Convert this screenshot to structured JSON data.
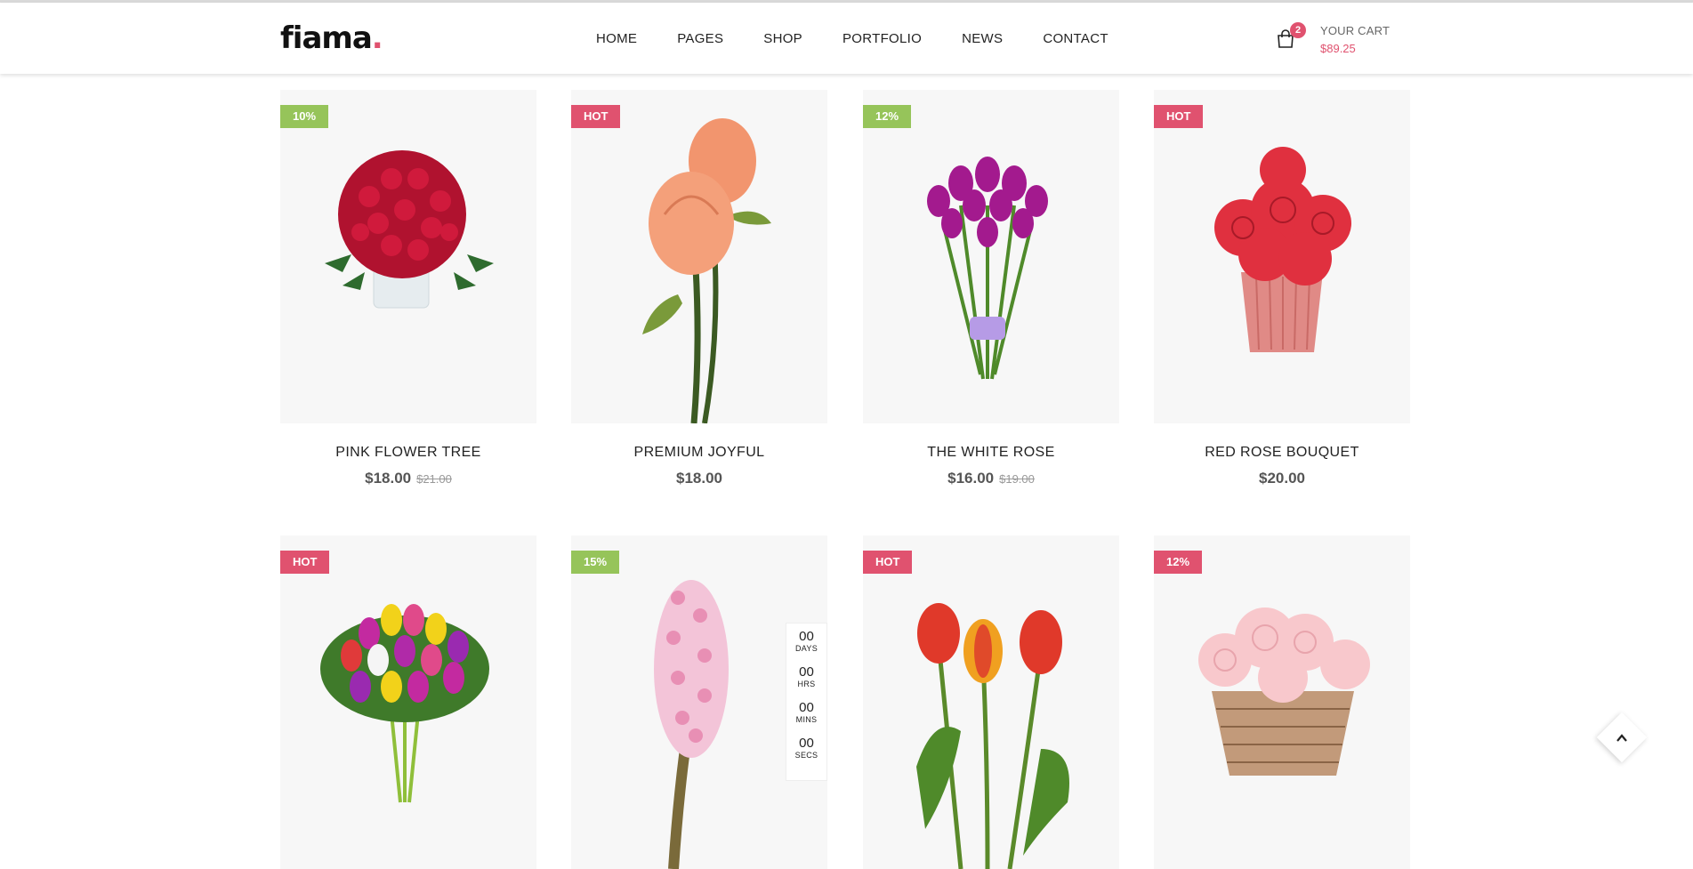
{
  "logo": {
    "text": "fiama",
    "dot": "."
  },
  "nav": [
    "HOME",
    "PAGES",
    "SHOP",
    "PORTFOLIO",
    "NEWS",
    "CONTACT"
  ],
  "cart": {
    "count": "2",
    "title": "YOUR CART",
    "total": "$89.25"
  },
  "products": [
    {
      "badge": "10%",
      "badge_color": "green",
      "title": "PINK FLOWER TREE",
      "price": "$18.00",
      "old_price": "$21.00",
      "image_icon": "red-roses-vase"
    },
    {
      "badge": "HOT",
      "badge_color": "pink",
      "title": "PREMIUM JOYFUL",
      "price": "$18.00",
      "old_price": "",
      "image_icon": "peach-roses"
    },
    {
      "badge": "12%",
      "badge_color": "green",
      "title": "THE WHITE ROSE",
      "price": "$16.00",
      "old_price": "$19.00",
      "image_icon": "purple-tulips"
    },
    {
      "badge": "HOT",
      "badge_color": "pink",
      "title": "RED ROSE BOUQUET",
      "price": "$20.00",
      "old_price": "",
      "image_icon": "red-roses-pot"
    },
    {
      "badge": "HOT",
      "badge_color": "pink",
      "title": "",
      "price": "",
      "old_price": "",
      "image_icon": "mixed-tulips"
    },
    {
      "badge": "15%",
      "badge_color": "green",
      "title": "",
      "price": "",
      "old_price": "",
      "image_icon": "pink-hyacinth"
    },
    {
      "badge": "HOT",
      "badge_color": "pink",
      "title": "",
      "price": "",
      "old_price": "",
      "image_icon": "red-tulips"
    },
    {
      "badge": "12%",
      "badge_color": "pink",
      "title": "",
      "price": "",
      "old_price": "",
      "image_icon": "pink-roses-basket"
    }
  ],
  "countdown": [
    {
      "num": "00",
      "label": "DAYS"
    },
    {
      "num": "00",
      "label": "HRS"
    },
    {
      "num": "00",
      "label": "MINS"
    },
    {
      "num": "00",
      "label": "SECS"
    }
  ],
  "colors": {
    "accent": "#e0526f",
    "green": "#96c45a"
  }
}
